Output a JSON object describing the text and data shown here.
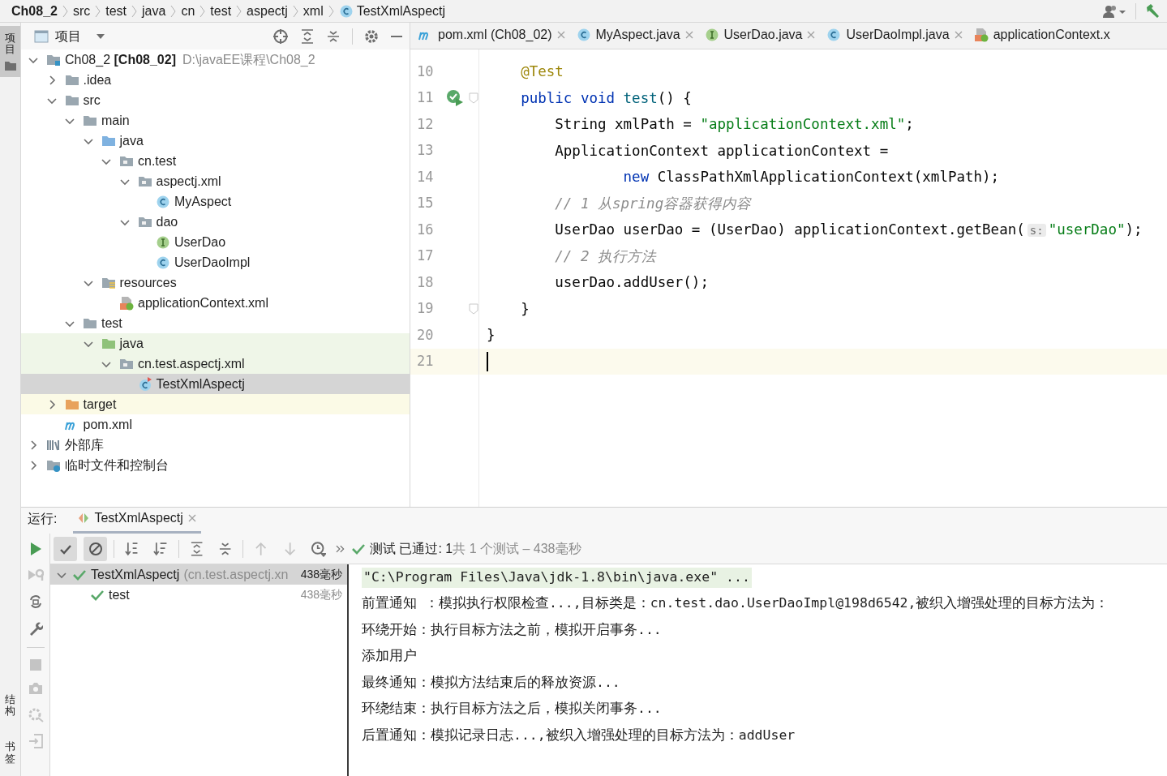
{
  "breadcrumbs": [
    {
      "label": "Ch08_2",
      "kind": "project"
    },
    {
      "label": "src",
      "kind": "folder"
    },
    {
      "label": "test",
      "kind": "folder"
    },
    {
      "label": "java",
      "kind": "folder"
    },
    {
      "label": "cn",
      "kind": "folder"
    },
    {
      "label": "test",
      "kind": "folder"
    },
    {
      "label": "aspectj",
      "kind": "folder"
    },
    {
      "label": "xml",
      "kind": "folder"
    },
    {
      "label": "TestXmlAspectj",
      "kind": "class"
    }
  ],
  "side_strip": {
    "top": [
      {
        "label": "项目",
        "selected": true
      }
    ],
    "bottom": [
      {
        "label": "结构",
        "selected": false
      },
      {
        "label": "书签",
        "selected": false
      }
    ]
  },
  "project_panel": {
    "title": "项目",
    "tree": [
      {
        "name": "Ch08_2 **[Ch08_02]**",
        "path": "D:\\javaEE课程\\Ch08_2",
        "kind": "module",
        "expanded": true,
        "selected": false,
        "children": [
          {
            "name": ".idea",
            "kind": "folder",
            "expanded": false,
            "selected": false
          },
          {
            "name": "src",
            "kind": "folder",
            "expanded": true,
            "selected": false,
            "children": [
              {
                "name": "main",
                "kind": "folder",
                "expanded": true,
                "selected": false,
                "children": [
                  {
                    "name": "java",
                    "kind": "source",
                    "expanded": true,
                    "selected": false,
                    "children": [
                      {
                        "name": "cn.test",
                        "kind": "package",
                        "expanded": true,
                        "selected": false,
                        "children": [
                          {
                            "name": "aspectj.xml",
                            "kind": "package",
                            "expanded": true,
                            "selected": false,
                            "children": [
                              {
                                "name": "MyAspect",
                                "kind": "class",
                                "selected": false
                              }
                            ]
                          },
                          {
                            "name": "dao",
                            "kind": "package",
                            "expanded": true,
                            "selected": false,
                            "children": [
                              {
                                "name": "UserDao",
                                "kind": "interface",
                                "selected": false
                              },
                              {
                                "name": "UserDaoImpl",
                                "kind": "class",
                                "selected": false
                              }
                            ]
                          }
                        ]
                      }
                    ]
                  },
                  {
                    "name": "resources",
                    "kind": "resources",
                    "expanded": true,
                    "selected": false,
                    "children": [
                      {
                        "name": "applicationContext.xml",
                        "kind": "spring",
                        "selected": false
                      }
                    ]
                  }
                ]
              },
              {
                "name": "test",
                "kind": "folder",
                "expanded": true,
                "selected": false,
                "children": [
                  {
                    "name": "java",
                    "kind": "test-source",
                    "expanded": true,
                    "selected": false,
                    "children": [
                      {
                        "name": "cn.test.aspectj.xml",
                        "kind": "test-package",
                        "expanded": true,
                        "selected": false,
                        "children": [
                          {
                            "name": "TestXmlAspectj",
                            "kind": "test-class",
                            "selected": true
                          }
                        ]
                      }
                    ]
                  }
                ]
              }
            ]
          },
          {
            "name": "target",
            "kind": "excluded",
            "expanded": false,
            "selected": false
          },
          {
            "name": "pom.xml",
            "kind": "maven",
            "selected": false
          }
        ]
      },
      {
        "name": "外部库",
        "kind": "library",
        "expanded": false,
        "selected": false
      },
      {
        "name": "临时文件和控制台",
        "kind": "scratch",
        "expanded": false,
        "selected": false
      }
    ]
  },
  "editor": {
    "tabs": [
      {
        "label": "pom.xml (Ch08_02)",
        "kind": "maven",
        "selected": false,
        "closable": true
      },
      {
        "label": "MyAspect.java",
        "kind": "class",
        "selected": false,
        "closable": true
      },
      {
        "label": "UserDao.java",
        "kind": "interface",
        "selected": false,
        "closable": true
      },
      {
        "label": "UserDaoImpl.java",
        "kind": "class",
        "selected": false,
        "closable": true
      },
      {
        "label": "applicationContext.x",
        "kind": "spring",
        "selected": false,
        "closable": false
      }
    ],
    "lines": [
      {
        "number": "10",
        "kind": "code",
        "tokens": [
          {
            "text": "    @Test",
            "kind": "annotation"
          }
        ]
      },
      {
        "number": "11",
        "kind": "test-method",
        "fold": true,
        "tokens": [
          {
            "text": "    public void ",
            "kind": "keyword"
          },
          {
            "text": "test",
            "kind": "method"
          },
          {
            "text": "() {",
            "kind": "plain"
          }
        ]
      },
      {
        "number": "12",
        "kind": "code",
        "tokens": [
          {
            "text": "        String xmlPath = ",
            "kind": "plain"
          },
          {
            "text": "\"applicationContext.xml\"",
            "kind": "string"
          },
          {
            "text": ";",
            "kind": "plain"
          }
        ]
      },
      {
        "number": "13",
        "kind": "code",
        "tokens": [
          {
            "text": "        ApplicationContext applicationContext =",
            "kind": "plain"
          }
        ]
      },
      {
        "number": "14",
        "kind": "code",
        "tokens": [
          {
            "text": "                new",
            "kind": "keyword"
          },
          {
            "text": " ClassPathXmlApplicationContext(xmlPath);",
            "kind": "plain"
          }
        ]
      },
      {
        "number": "15",
        "kind": "code",
        "tokens": [
          {
            "text": "        // 1 从spring容器获得内容",
            "kind": "comment"
          }
        ]
      },
      {
        "number": "16",
        "kind": "code",
        "tokens": [
          {
            "text": "        UserDao userDao = (UserDao) applicationContext.getBean(",
            "kind": "plain"
          },
          {
            "text": "s:",
            "kind": "hint"
          },
          {
            "text": "\"userDao\"",
            "kind": "string"
          },
          {
            "text": ");",
            "kind": "plain"
          }
        ]
      },
      {
        "number": "17",
        "kind": "code",
        "tokens": [
          {
            "text": "        // 2 执行方法",
            "kind": "comment"
          }
        ]
      },
      {
        "number": "18",
        "kind": "code",
        "tokens": [
          {
            "text": "        userDao.addUser();",
            "kind": "plain"
          }
        ]
      },
      {
        "number": "19",
        "kind": "code",
        "fold": true,
        "tokens": [
          {
            "text": "    }",
            "kind": "plain"
          }
        ]
      },
      {
        "number": "20",
        "kind": "code",
        "tokens": [
          {
            "text": "}",
            "kind": "plain"
          }
        ]
      },
      {
        "number": "21",
        "kind": "code",
        "current": true
      }
    ]
  },
  "run_panel": {
    "label": "运行:",
    "tab": "TestXmlAspectj",
    "toggles": [
      {
        "kind": "passed",
        "selected": true
      },
      {
        "kind": "ignored",
        "selected": true
      }
    ],
    "status": {
      "label": "测试 已通过: 1",
      "detail": "共 1 个测试 – 438毫秒"
    },
    "tests": [
      {
        "name": "TestXmlAspectj",
        "detail": "(cn.test.aspectj.xn",
        "time": "438毫秒",
        "selected": true,
        "expanded": true,
        "children": [
          {
            "name": "test",
            "time": "438毫秒",
            "selected": false
          }
        ]
      }
    ],
    "console": [
      {
        "text": "\"C:\\Program Files\\Java\\jdk-1.8\\bin\\java.exe\" ...",
        "kind": "command"
      },
      {
        "text": "前置通知 ：模拟执行权限检查...,目标类是：cn.test.dao.UserDaoImpl@198d6542,被织入增强处理的目标方法为：",
        "kind": "output"
      },
      {
        "text": "环绕开始：执行目标方法之前，模拟开启事务...",
        "kind": "output"
      },
      {
        "text": "添加用户",
        "kind": "output"
      },
      {
        "text": "最终通知：模拟方法结束后的释放资源...",
        "kind": "output"
      },
      {
        "text": "环绕结束：执行目标方法之后，模拟关闭事务...",
        "kind": "output"
      },
      {
        "text": "后置通知：模拟记录日志...,被织入增强处理的目标方法为：addUser",
        "kind": "output"
      }
    ]
  }
}
